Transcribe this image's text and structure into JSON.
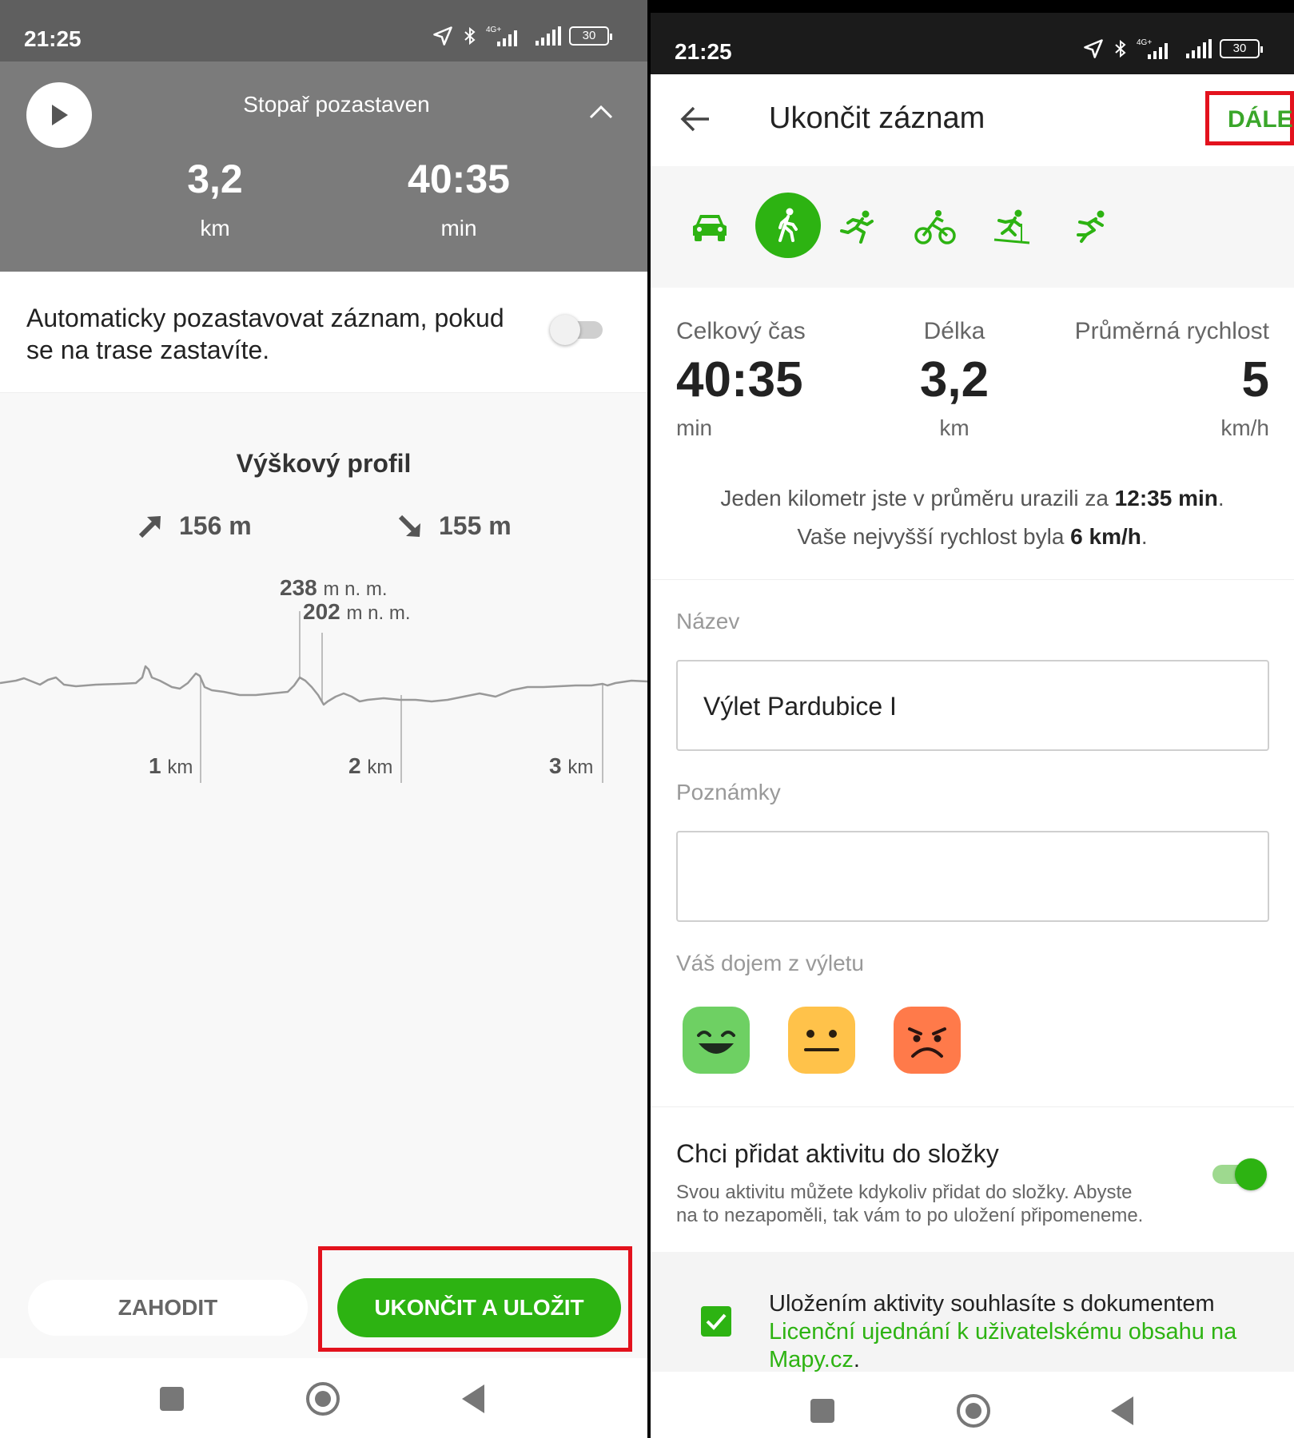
{
  "left": {
    "status": {
      "time": "21:25",
      "network": "4G+",
      "battery": "30"
    },
    "tracker": {
      "title": "Stopař pozastaven",
      "distance_value": "3,2",
      "distance_unit": "km",
      "time_value": "40:35",
      "time_unit": "min"
    },
    "auto_pause": {
      "label": "Automaticky pozastavovat záznam, pokud se na trase zastavíte.",
      "enabled": false
    },
    "profile": {
      "title": "Výškový profil",
      "ascent": "156 m",
      "descent": "155 m",
      "max_value": "238",
      "min_value": "202",
      "elev_unit": "m n. m.",
      "km_unit": "km",
      "km_marks": [
        "1",
        "2",
        "3"
      ]
    },
    "buttons": {
      "discard": "ZAHODIT",
      "save": "UKONČIT A ULOŽIT"
    }
  },
  "right": {
    "status": {
      "time": "21:25",
      "network": "4G+",
      "battery": "30"
    },
    "header": {
      "title": "Ukončit záznam",
      "next": "DÁLE"
    },
    "activities": [
      "car-icon",
      "walk-icon",
      "run-icon",
      "bike-icon",
      "ski-icon",
      "skate-icon"
    ],
    "selected_activity": "walk-icon",
    "stats": {
      "time_label": "Celkový čas",
      "time_value": "40:35",
      "time_unit": "min",
      "length_label": "Délka",
      "length_value": "3,2",
      "length_unit": "km",
      "speed_label": "Průměrná rychlost",
      "speed_value": "5",
      "speed_unit": "km/h"
    },
    "pace": {
      "prefix": "Jeden kilometr jste v průměru urazili za ",
      "value": "12:35 min",
      "suffix": ".",
      "max_prefix": "Vaše nejvyšší rychlost byla ",
      "max_value": "6 km/h",
      "max_suffix": "."
    },
    "form": {
      "name_label": "Název",
      "name_value": "Výlet Pardubice I",
      "notes_label": "Poznámky",
      "notes_value": "",
      "mood_label": "Váš dojem z výletu"
    },
    "folder": {
      "title": "Chci přidat aktivitu do složky",
      "description": "Svou aktivitu můžete kdykoliv přidat do složky. Abyste na to nezapoměli, tak vám to po uložení připomeneme.",
      "enabled": true
    },
    "consent": {
      "text": "Uložením aktivity souhlasíte s dokumentem ",
      "link": "Licenční ujednání k uživatelskému obsahu na Mapy.cz",
      "suffix": ".",
      "checked": true
    }
  },
  "colors": {
    "accent": "#2db312",
    "highlight": "#e3121d",
    "tracker_bg": "#7b7b7b"
  }
}
